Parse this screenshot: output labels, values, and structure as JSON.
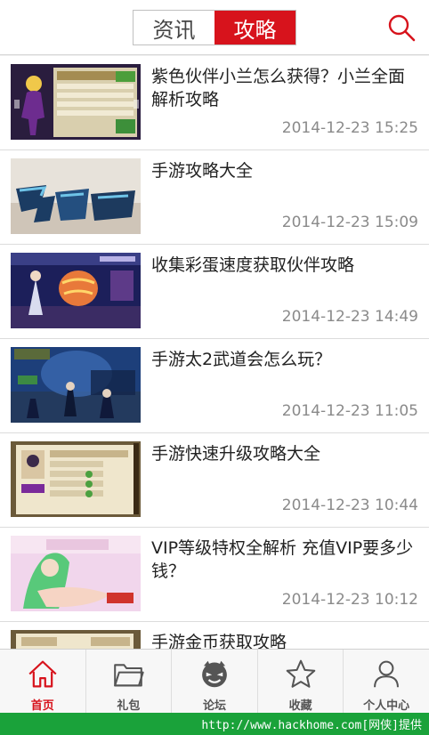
{
  "header": {
    "tabs": [
      {
        "label": "资讯",
        "active": false
      },
      {
        "label": "攻略",
        "active": true
      }
    ],
    "search_icon": "search-icon"
  },
  "articles": [
    {
      "title": "紫色伙伴小兰怎么获得？小兰全面解析攻略",
      "date": "2014-12-23 15:25",
      "thumb": "character-card-screenshot"
    },
    {
      "title": "手游攻略大全",
      "date": "2014-12-23 15:09",
      "thumb": "game-logo-banner"
    },
    {
      "title": "收集彩蛋速度获取伙伴攻略",
      "date": "2014-12-23 14:49",
      "thumb": "egg-battle-screenshot"
    },
    {
      "title": "手游太2武道会怎么玩？",
      "date": "2014-12-23 11:05",
      "thumb": "arena-screenshot"
    },
    {
      "title": "手游快速升级攻略大全",
      "date": "2014-12-23 10:44",
      "thumb": "level-up-screenshot"
    },
    {
      "title": "VIP等级特权全解析 充值VIP要多少钱？",
      "date": "2014-12-23 10:12",
      "thumb": "vip-character-screenshot"
    },
    {
      "title": "手游金币获取攻略",
      "date": "",
      "thumb": "gold-screenshot"
    }
  ],
  "nav": [
    {
      "label": "首页",
      "icon": "home-icon",
      "active": true
    },
    {
      "label": "礼包",
      "icon": "folder-icon",
      "active": false
    },
    {
      "label": "论坛",
      "icon": "forum-face-icon",
      "active": false
    },
    {
      "label": "收藏",
      "icon": "star-icon",
      "active": false
    },
    {
      "label": "个人中心",
      "icon": "user-icon",
      "active": false
    }
  ],
  "watermark": "http://www.hackhome.com[网侠]提供",
  "colors": {
    "accent": "#d7131c",
    "watermark_bg": "#1aa23a"
  }
}
